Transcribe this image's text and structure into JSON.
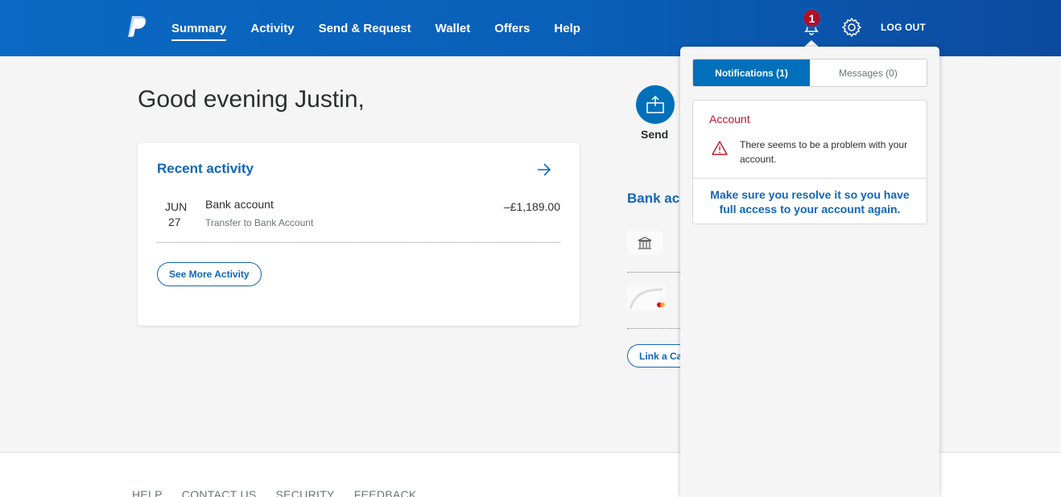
{
  "header": {
    "nav": [
      "Summary",
      "Activity",
      "Send & Request",
      "Wallet",
      "Offers",
      "Help"
    ],
    "active_nav": "Summary",
    "notification_count": "1",
    "logout_label": "LOG OUT",
    "brand_color": "#0a5fb8"
  },
  "main": {
    "greeting": "Good evening Justin,",
    "recent_activity": {
      "title": "Recent activity",
      "items": [
        {
          "month": "JUN",
          "day": "27",
          "name": "Bank account",
          "description": "Transfer to Bank Account",
          "amount": "–£1,189.00"
        }
      ],
      "see_more_label": "See More Activity"
    },
    "send_label": "Send",
    "bank_title": "Bank accounts and cards",
    "link_card_label": "Link a Card"
  },
  "footer": {
    "links": [
      "HELP",
      "CONTACT US",
      "SECURITY",
      "FEEDBACK"
    ]
  },
  "notifications_panel": {
    "tabs": [
      "Notifications (1)",
      "Messages (0)"
    ],
    "active_tab": "Notifications (1)",
    "items": [
      {
        "category": "Account",
        "message": "There seems to be a problem with your account.",
        "action": "Make sure you resolve it so you have full access to your account again.",
        "icon": "warning-icon"
      }
    ],
    "alert_color": "#c4162a"
  }
}
